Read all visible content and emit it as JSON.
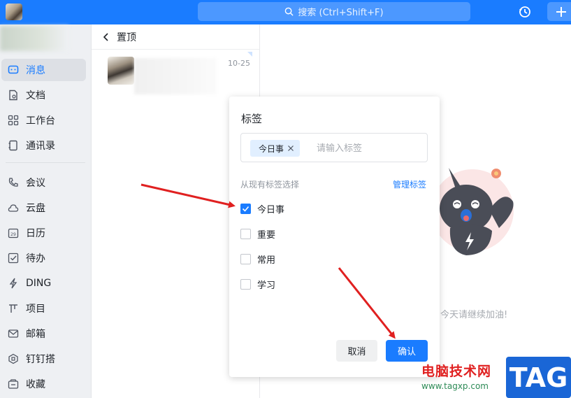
{
  "topbar": {
    "search_placeholder": "搜索 (Ctrl+Shift+F)",
    "icons": [
      "app-avatar",
      "search-icon",
      "history-icon",
      "plus-icon"
    ]
  },
  "sidebar": {
    "items": [
      {
        "label": "消息",
        "icon": "message-icon",
        "active": true
      },
      {
        "label": "文档",
        "icon": "document-icon"
      },
      {
        "label": "工作台",
        "icon": "workbench-icon"
      },
      {
        "label": "通讯录",
        "icon": "contacts-icon"
      },
      {
        "label": "会议",
        "icon": "meeting-icon"
      },
      {
        "label": "云盘",
        "icon": "cloud-icon"
      },
      {
        "label": "日历",
        "icon": "calendar-icon"
      },
      {
        "label": "待办",
        "icon": "todo-icon"
      },
      {
        "label": "DING",
        "icon": "ding-icon"
      },
      {
        "label": "项目",
        "icon": "project-icon"
      },
      {
        "label": "邮箱",
        "icon": "mail-icon"
      },
      {
        "label": "钉钉搭",
        "icon": "builder-icon"
      },
      {
        "label": "收藏",
        "icon": "favorites-icon"
      }
    ]
  },
  "conversations": {
    "header": "置顶",
    "items": [
      {
        "time": "10-25"
      }
    ]
  },
  "main": {
    "hint": "今天请继续加油!"
  },
  "dialog": {
    "title": "标签",
    "selected_chip": "今日事",
    "input_placeholder": "请输入标签",
    "subtitle": "从现有标签选择",
    "manage_link": "管理标签",
    "options": [
      {
        "label": "今日事",
        "checked": true
      },
      {
        "label": "重要",
        "checked": false
      },
      {
        "label": "常用",
        "checked": false
      },
      {
        "label": "学习",
        "checked": false
      }
    ],
    "cancel_label": "取消",
    "ok_label": "确认"
  },
  "watermark": {
    "site_name": "电脑技术网",
    "url": "www.tagxp.com",
    "badge": "TAG"
  },
  "colors": {
    "accent": "#1a7cff",
    "arrow": "#e02020"
  }
}
